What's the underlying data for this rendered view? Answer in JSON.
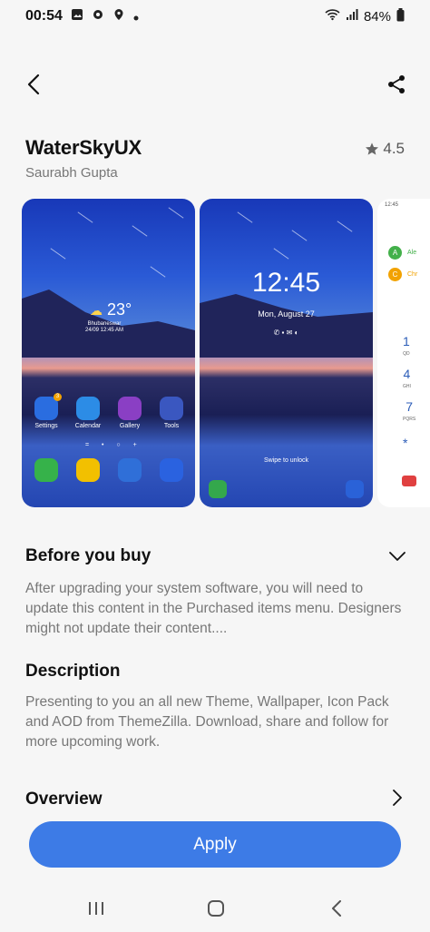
{
  "status_bar": {
    "time": "00:54",
    "battery": "84%",
    "left_icons": [
      "gallery-icon",
      "settings-icon",
      "location-icon",
      "dot-icon"
    ],
    "right_icons": [
      "wifi-icon",
      "signal-icon",
      "battery-icon"
    ]
  },
  "header": {
    "back_icon": "chevron-left-icon",
    "share_icon": "share-icon"
  },
  "theme": {
    "title": "WaterSkyUX",
    "author": "Saurabh Gupta",
    "rating": "4.5"
  },
  "previews": {
    "home": {
      "temperature": "23°",
      "location": "Bhubaneswar",
      "datetime": "24/09 12:45 AM",
      "apps": [
        "Settings",
        "Calendar",
        "Gallery",
        "Tools"
      ],
      "badge": "3"
    },
    "lock": {
      "time": "12:45",
      "date": "Mon, August 27",
      "swipe": "Swipe to unlock"
    },
    "dialer": {
      "time": "12:45",
      "contacts": [
        {
          "initial": "A",
          "name": "Ale",
          "color": "#43b04a"
        },
        {
          "initial": "C",
          "name": "Chr",
          "color": "#f2a200"
        }
      ],
      "keys": [
        {
          "digit": "1",
          "sub": "QD"
        },
        {
          "digit": "4",
          "sub": "GHI"
        },
        {
          "digit": "7",
          "sub": "PQRS"
        },
        {
          "digit": "*",
          "sub": ""
        }
      ]
    }
  },
  "sections": {
    "before_buy": {
      "title": "Before you buy",
      "text": "After upgrading your system software, you will need to update this content in the Purchased items menu. Designers might not update their content...."
    },
    "description": {
      "title": "Description",
      "text": "Presenting to you an all new Theme, Wallpaper, Icon Pack and AOD from ThemeZilla. Download, share and follow for more upcoming work."
    },
    "overview": {
      "title": "Overview"
    }
  },
  "actions": {
    "apply_label": "Apply"
  },
  "colors": {
    "accent": "#3d7be6",
    "background": "#f6f6f6"
  }
}
